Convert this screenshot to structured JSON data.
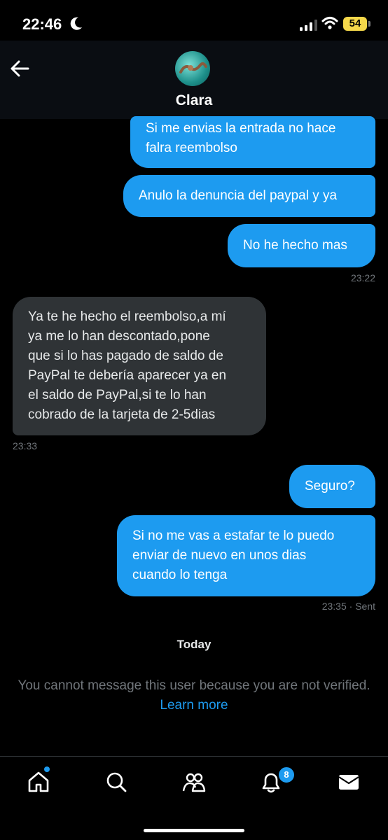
{
  "status_bar": {
    "time": "22:46",
    "battery": "54"
  },
  "header": {
    "contact_name": "Clara"
  },
  "messages": [
    {
      "lines": [
        "Si me envias la entrada no hace",
        "falra reembolso"
      ]
    },
    {
      "lines": [
        "Anulo la denuncia del paypal y ya"
      ]
    },
    {
      "lines": [
        "No he hecho mas"
      ],
      "time": "23:22"
    },
    {
      "lines": [
        "Ya te he hecho el reembolso,a mí",
        "ya me lo han descontado,pone",
        "que si lo has pagado de saldo de",
        "PayPal te debería aparecer ya en",
        "el saldo de PayPal,si te lo han",
        "cobrado de la tarjeta de 2-5dias"
      ],
      "time": "23:33"
    },
    {
      "lines": [
        "Seguro?"
      ]
    },
    {
      "lines": [
        "Si no me vas a estafar te lo puedo",
        "enviar de nuevo en unos dias",
        "cuando lo tenga"
      ],
      "time": "23:35 · Sent"
    }
  ],
  "day_separator": "Today",
  "notice": {
    "text": "You cannot message this user because you are not verified.",
    "link": "Learn more"
  },
  "nav": {
    "notifications_badge": "8"
  },
  "colors": {
    "accent": "#1d9bf0",
    "incoming_bubble": "#2f3336",
    "battery": "#f5d84a"
  }
}
